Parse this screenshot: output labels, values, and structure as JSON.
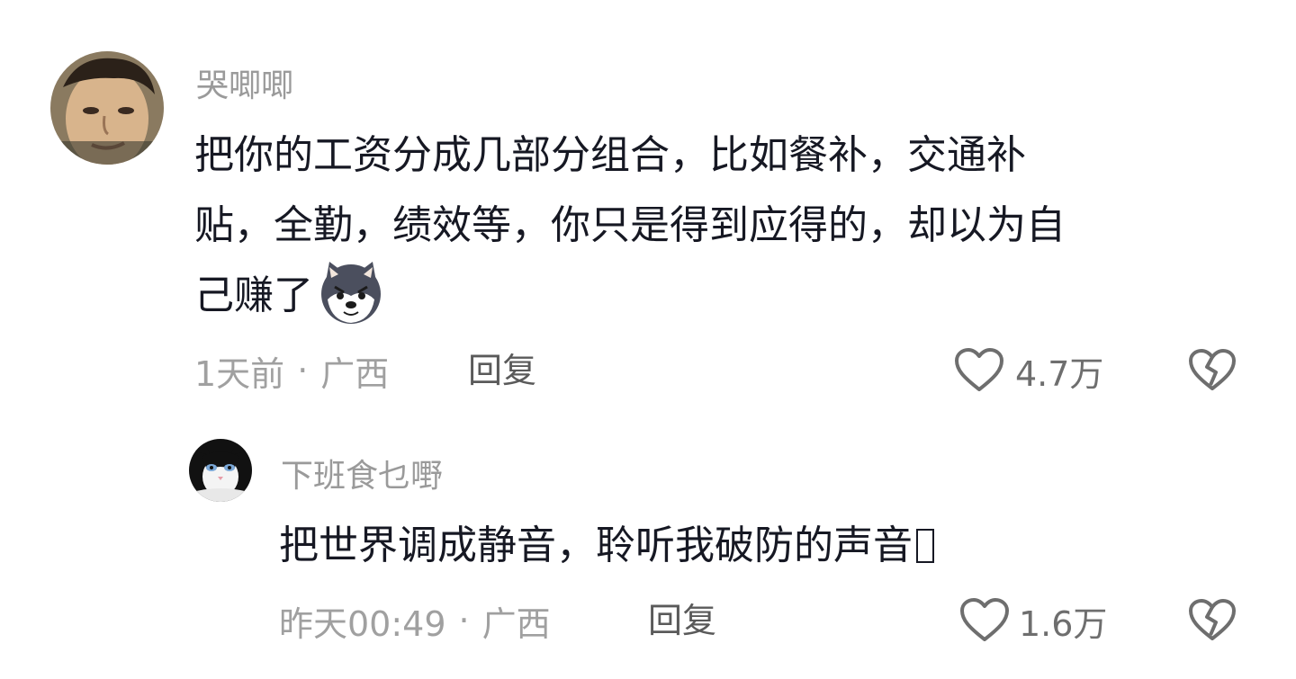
{
  "comments": [
    {
      "username": "哭唧唧",
      "text_lines": [
        "把你的工资分成几部分组合，比如餐补，交通补",
        "贴，全勤，绩效等，你只是得到应得的，却以为自",
        "己赚了"
      ],
      "inline_emoji": "husky-dog-emoji",
      "time": "1天前",
      "separator": "·",
      "location": "广西",
      "reply_label": "回复",
      "like_count": "4.7万",
      "like_icon": "heart-outline-icon",
      "dislike_icon": "broken-heart-icon",
      "avatar": "man-face-avatar"
    },
    {
      "username": "下班食乜嘢",
      "text": "把世界调成静音，聆听我破防的声音",
      "trailing_glyph": "unrenderable-emoji-box",
      "time": "昨天00:49",
      "separator": "·",
      "location": "广西",
      "reply_label": "回复",
      "like_count": "1.6万",
      "like_icon": "heart-outline-icon",
      "dislike_icon": "broken-heart-icon",
      "avatar": "black-white-cat-avatar"
    }
  ],
  "colors": {
    "text": "#161823",
    "username": "#9a9a9a",
    "meta": "#a0a0a0",
    "reply": "#5a5a5a",
    "icon": "#6e6e6e"
  }
}
